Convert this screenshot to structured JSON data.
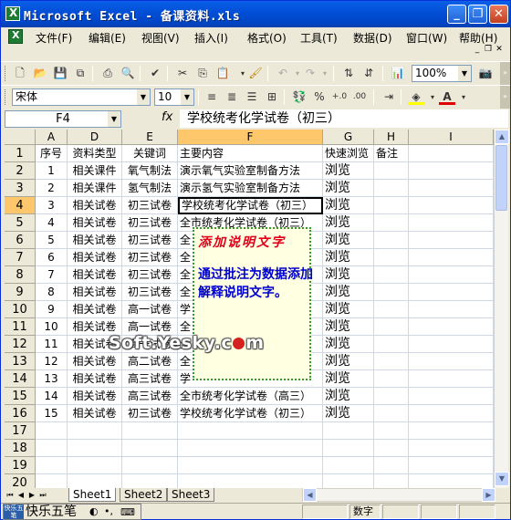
{
  "window": {
    "title": "Microsoft Excel - 备课资料.xls",
    "minimize_glyph": "_",
    "restore_glyph": "❐",
    "close_glyph": "✕"
  },
  "menu": {
    "items": [
      "文件(F)",
      "编辑(E)",
      "视图(V)",
      "插入(I)",
      "格式(O)",
      "工具(T)",
      "数据(D)",
      "窗口(W)",
      "帮助(H)"
    ]
  },
  "toolbar": {
    "zoom": "100%",
    "font": "宋体",
    "font_size": "10"
  },
  "formula_bar": {
    "name_box": "F4",
    "fx": "fx",
    "content": "学校统考化学试卷（初三）"
  },
  "grid": {
    "col_headers": [
      "A",
      "D",
      "E",
      "F",
      "G",
      "H",
      "I"
    ],
    "header_row": [
      "序号",
      "资料类型",
      "关键词",
      "主要内容",
      "快速浏览",
      "备注"
    ],
    "rows": [
      {
        "n": "1",
        "cells": [
          "序号",
          "资料类型",
          "关键词",
          "主要内容",
          "快速浏览",
          "备注"
        ]
      },
      {
        "n": "2",
        "cells": [
          "1",
          "相关课件",
          "氧气制法",
          "演示氧气实验室制备方法",
          "浏览",
          ""
        ]
      },
      {
        "n": "3",
        "cells": [
          "2",
          "相关课件",
          "氢气制法",
          "演示氢气实验室制备方法",
          "浏览",
          ""
        ]
      },
      {
        "n": "4",
        "cells": [
          "3",
          "相关试卷",
          "初三试卷",
          "学校统考化学试卷（初三）",
          "浏览",
          ""
        ]
      },
      {
        "n": "5",
        "cells": [
          "4",
          "相关试卷",
          "初三试卷",
          "全市统考化学试卷（初三）",
          "浏览",
          ""
        ]
      },
      {
        "n": "6",
        "cells": [
          "5",
          "相关试卷",
          "初三试卷",
          "全",
          "浏览",
          ""
        ]
      },
      {
        "n": "7",
        "cells": [
          "6",
          "相关试卷",
          "初三试卷",
          "全",
          "浏览",
          ""
        ]
      },
      {
        "n": "8",
        "cells": [
          "7",
          "相关试卷",
          "初三试卷",
          "全",
          "浏览",
          ""
        ]
      },
      {
        "n": "9",
        "cells": [
          "8",
          "相关试卷",
          "初三试卷",
          "全",
          "浏览",
          ""
        ]
      },
      {
        "n": "10",
        "cells": [
          "9",
          "相关试卷",
          "高一试卷",
          "学",
          "浏览",
          ""
        ]
      },
      {
        "n": "11",
        "cells": [
          "10",
          "相关试卷",
          "高一试卷",
          "全",
          "浏览",
          ""
        ]
      },
      {
        "n": "12",
        "cells": [
          "11",
          "相关试卷",
          "高一试卷",
          "全",
          "浏览",
          ""
        ]
      },
      {
        "n": "13",
        "cells": [
          "12",
          "相关试卷",
          "高二试卷",
          "全",
          "浏览",
          ""
        ]
      },
      {
        "n": "14",
        "cells": [
          "13",
          "相关试卷",
          "高三试卷",
          "学",
          "浏览",
          ""
        ]
      },
      {
        "n": "15",
        "cells": [
          "14",
          "相关试卷",
          "高三试卷",
          "全市统考化学试卷（高三）",
          "浏览",
          ""
        ]
      },
      {
        "n": "16",
        "cells": [
          "15",
          "相关试卷",
          "初三试卷",
          "学校统考化学试卷（初三）",
          "浏览",
          ""
        ]
      },
      {
        "n": "17",
        "cells": [
          "",
          "",
          "",
          "",
          "",
          ""
        ]
      },
      {
        "n": "18",
        "cells": [
          "",
          "",
          "",
          "",
          "",
          ""
        ]
      },
      {
        "n": "19",
        "cells": [
          "",
          "",
          "",
          "",
          "",
          ""
        ]
      },
      {
        "n": "20",
        "cells": [
          "",
          "",
          "",
          "",
          "",
          ""
        ]
      },
      {
        "n": "21",
        "cells": [
          "",
          "",
          "",
          "",
          "",
          ""
        ]
      }
    ]
  },
  "comment": {
    "title": "添加说明文字",
    "body": "通过批注为数据添加解释说明文字。"
  },
  "watermark": {
    "text_before": "Soft.Yesky.c",
    "text_after": "m"
  },
  "tabs": [
    "Sheet1",
    "Sheet2",
    "Sheet3"
  ],
  "status": {
    "ime_logo": "快乐五笔",
    "ime_name": "快乐五笔",
    "mode": "数字"
  }
}
